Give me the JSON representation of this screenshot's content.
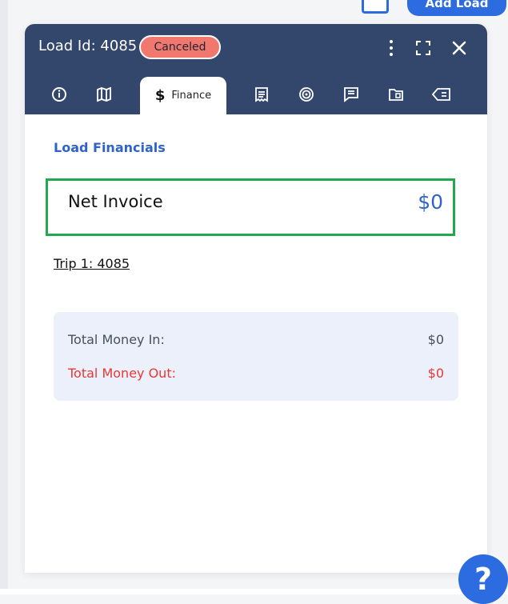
{
  "background": {
    "add_button_label": "Add Load"
  },
  "header": {
    "title": "Load Id: 4085",
    "status_badge": "Canceled"
  },
  "tabs": [
    {
      "icon": "info-icon"
    },
    {
      "icon": "map-icon"
    },
    {
      "icon": "dollar-icon",
      "label": "Finance",
      "active": true
    },
    {
      "icon": "receipt-icon"
    },
    {
      "icon": "tracking-icon"
    },
    {
      "icon": "notes-icon"
    },
    {
      "icon": "folder-icon"
    },
    {
      "icon": "tag-delete-icon"
    }
  ],
  "finance": {
    "section_title": "Load Financials",
    "net_invoice_label": "Net Invoice",
    "net_invoice_value": "$0",
    "trip_link": "Trip 1: 4085",
    "total_money_in_label": "Total Money In:",
    "total_money_in_value": "$0",
    "total_money_out_label": "Total Money Out:",
    "total_money_out_value": "$0"
  },
  "help": {
    "label": "?"
  },
  "colors": {
    "header_bg": "#33466b",
    "accent_blue": "#2f63c7",
    "success_green": "#22a84f",
    "danger_red": "#e53935",
    "badge_bg": "#f0786e",
    "summary_bg": "#ebf0fa"
  }
}
